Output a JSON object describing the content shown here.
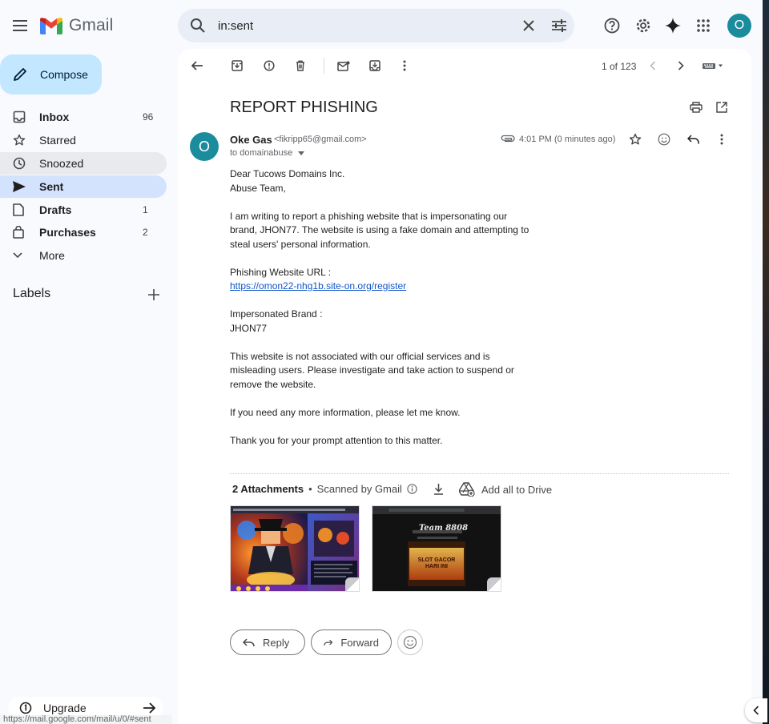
{
  "app": {
    "name": "Gmail"
  },
  "search": {
    "query": "in:sent"
  },
  "user": {
    "initial": "O"
  },
  "compose_label": "Compose",
  "sidebar": {
    "items": [
      {
        "label": "Inbox",
        "count": "96"
      },
      {
        "label": "Starred",
        "count": ""
      },
      {
        "label": "Snoozed",
        "count": ""
      },
      {
        "label": "Sent",
        "count": ""
      },
      {
        "label": "Drafts",
        "count": "1"
      },
      {
        "label": "Purchases",
        "count": "2"
      },
      {
        "label": "More",
        "count": ""
      }
    ],
    "labels_heading": "Labels",
    "upgrade_label": "Upgrade",
    "status_url": "https://mail.google.com/mail/u/0/#sent"
  },
  "toolbar": {
    "pager": "1 of 123"
  },
  "email": {
    "subject": "REPORT PHISHING",
    "sender_name": "Oke Gas",
    "sender_email": "<fikripp65@gmail.com>",
    "sender_initial": "O",
    "recipient": "to domainabuse",
    "time": "4:01 PM (0 minutes ago)",
    "body": {
      "p1_l1": "Dear Tucows Domains Inc.",
      "p1_l2": "Abuse Team,",
      "p2_l1": "I am writing to report a phishing website that is impersonating our",
      "p2_l2": "brand, JHON77. The website is using a fake domain and attempting to",
      "p2_l3": "steal users' personal information.",
      "p3_label": "Phishing Website URL :",
      "p3_url": "https://omon22-nhg1b.site-on.org/register",
      "p4_label": "Impersonated Brand :",
      "p4_value": "JHON77",
      "p5_l1": "This website is not associated with our official services and is",
      "p5_l2": "misleading users. Please investigate and take action to suspend or",
      "p5_l3": "remove the website.",
      "p6": "If you need any more information, please let me know.",
      "p7": "Thank you for your prompt attention to this matter."
    },
    "attachments": {
      "count_label": "2 Attachments",
      "scanned_label": "Scanned by Gmail",
      "drive_label": "Add all to Drive",
      "thumb2_title": "Team 8808",
      "thumb2_banner": "SLOT GACOR HARI INI"
    }
  },
  "actions": {
    "reply": "Reply",
    "forward": "Forward"
  },
  "colors": {
    "accent": "#0b57d0",
    "compose_bg": "#c2e7ff",
    "active_nav": "#d3e3fd",
    "avatar": "#1a8c9c"
  }
}
